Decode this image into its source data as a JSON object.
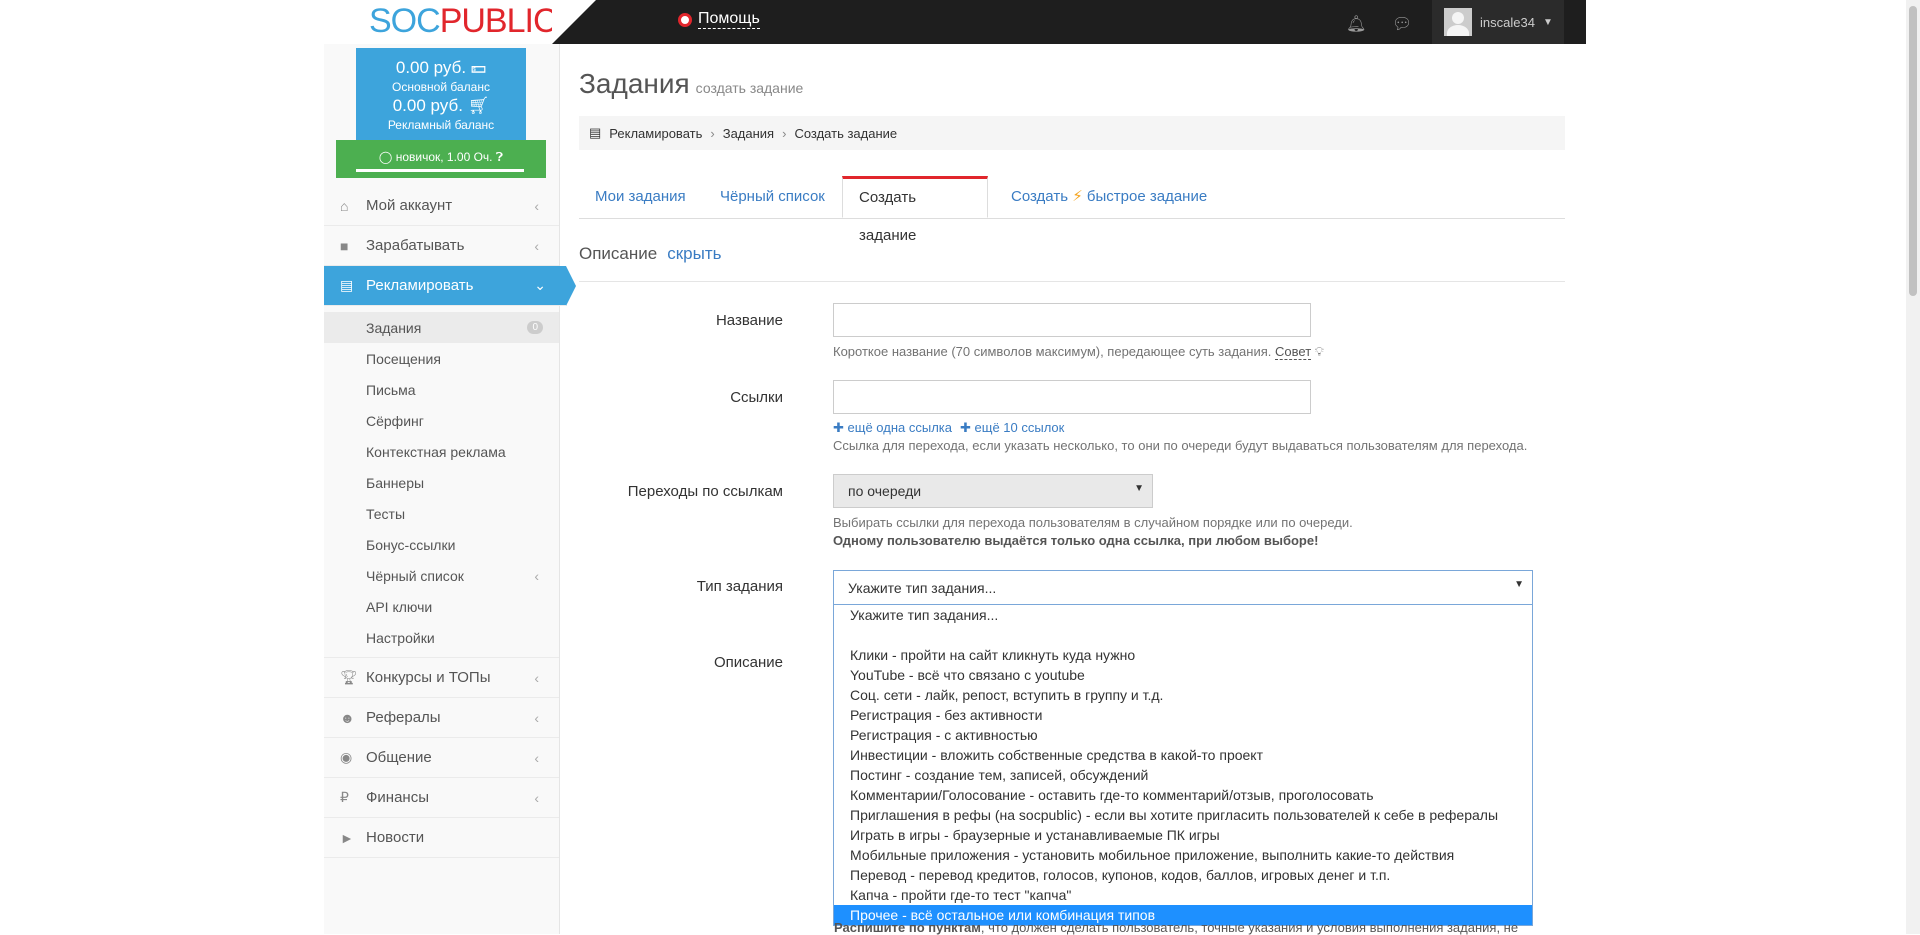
{
  "header": {
    "logo_part1": "SOC",
    "logo_part2": "PUBLIC",
    "help_label": "Помощь",
    "username": "inscale34"
  },
  "sidebar": {
    "balance_main_amount": "0.00 руб.",
    "balance_main_label": "Основной баланс",
    "balance_ad_amount": "0.00 руб.",
    "balance_ad_label": "Рекламный баланс",
    "level": "новичок, 1.00 Оч.",
    "menu": {
      "account": "Мой аккаунт",
      "earn": "Зарабатывать",
      "advertise": "Рекламировать",
      "contests": "Конкурсы и ТОПы",
      "referrals": "Рефералы",
      "chat": "Общение",
      "finance": "Финансы",
      "news": "Новости"
    },
    "submenu": {
      "tasks": "Задания",
      "tasks_count": "0",
      "visits": "Посещения",
      "letters": "Письма",
      "surfing": "Сёрфинг",
      "context": "Контекстная реклама",
      "banners": "Баннеры",
      "tests": "Тесты",
      "bonus": "Бонус-ссылки",
      "blacklist": "Чёрный список",
      "api": "API ключи",
      "settings": "Настройки"
    }
  },
  "main": {
    "title": "Задания",
    "subtitle": "создать задание",
    "breadcrumb": [
      "Рекламировать",
      "Задания",
      "Создать задание"
    ],
    "tabs": {
      "my_tasks": "Мои задания",
      "blacklist": "Чёрный список",
      "create": "Создать задание",
      "quick_pre": "Создать",
      "quick_post": "быстрое задание"
    },
    "section_title": "Описание",
    "section_toggle": "скрыть",
    "form": {
      "name_label": "Название",
      "name_help": "Короткое название (70 символов максимум), передающее суть задания.",
      "name_tip": "Совет",
      "links_label": "Ссылки",
      "add_one_link": "ещё одна ссылка",
      "add_ten_links": "ещё 10 ссылок",
      "links_help": "Ссылка для перехода, если указать несколько, то они по очереди будут выдаваться пользователям для перехода.",
      "transitions_label": "Переходы по ссылкам",
      "transitions_value": "по очереди",
      "transitions_help": "Выбирать ссылки для перехода пользователям в случайном порядке или по очереди.",
      "transitions_help_bold": "Одному пользователю выдаётся только одна ссылка, при любом выборе!",
      "type_label": "Тип задания",
      "type_value": "Укажите тип задания...",
      "description_label": "Описание",
      "type_options": [
        "Укажите тип задания...",
        "",
        "Клики - пройти на сайт кликнуть куда нужно",
        "YouTube - всё что связано с youtube",
        "Соц. сети - лайк, репост, вступить в группу и т.д.",
        "Регистрация - без активности",
        "Регистрация - с активностью",
        "Инвестиции - вложить собственные средства в какой-то проект",
        "Постинг - создание тем, записей, обсуждений",
        "Комментарии/Голосование - оставить где-то комментарий/отзыв, проголосовать",
        "Приглашения в рефы (на socpublic) - если вы хотите пригласить пользователей к себе в рефералы",
        "Играть в игры - браузерные и устанавливаемые ПК игры",
        "Мобильные приложения - установить мобильное приложение, выполнить какие-то действия",
        "Перевод - перевод кредитов, голосов, купонов, кодов, баллов, игровых денег и т.п.",
        "Капча - пройти где-то тест \"капча\"",
        "Прочее - всё остальное или комбинация типов"
      ],
      "bottom_bold": "Распишите по пунктам",
      "bottom_rest": ", что должен сделать пользователь, точные указания и условия выполнения задания, не"
    }
  }
}
